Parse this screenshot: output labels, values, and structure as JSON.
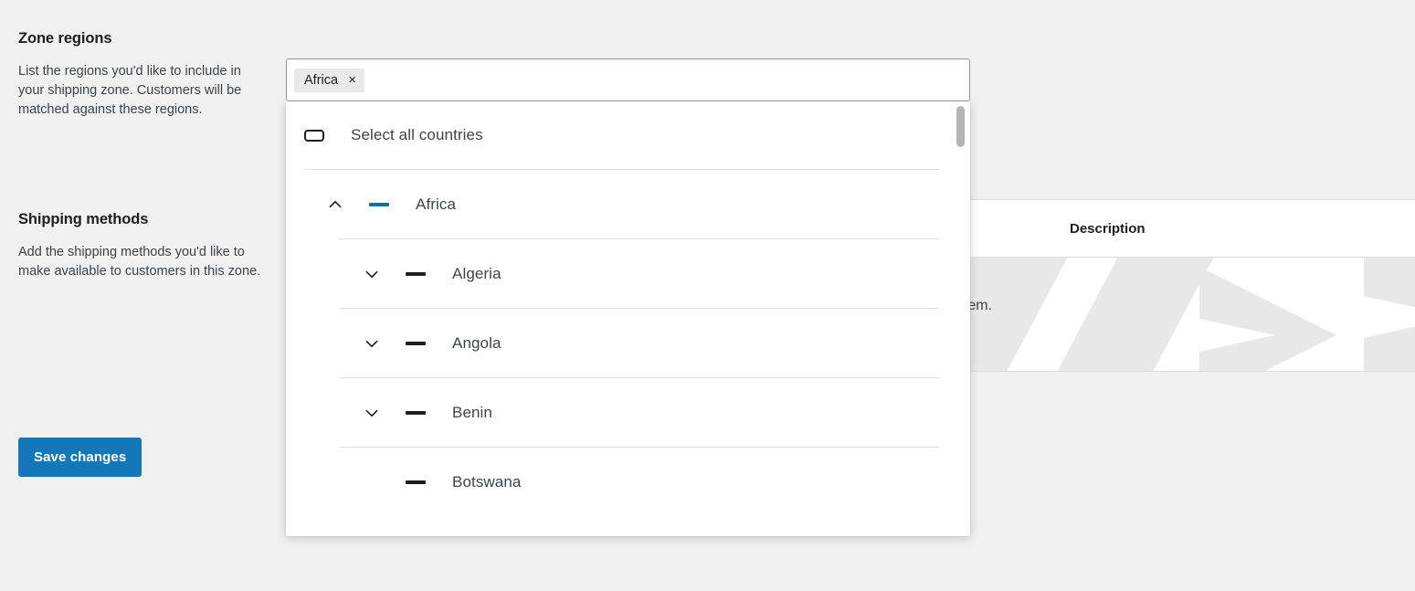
{
  "theme": {
    "accent_blue": "#1278ba",
    "indeterminate_blue": "#0e74a8",
    "indeterminate_dark": "#1e1e1e",
    "page_bg": "#f0f0f0",
    "panel_bg": "#ffffff"
  },
  "sidebar": {
    "zone_regions": {
      "title": "Zone regions",
      "description": "List the regions you'd like to include in your shipping zone. Customers will be matched against these regions."
    },
    "shipping_methods": {
      "title": "Shipping methods",
      "description": "Add the shipping methods you'd like to make available to customers in this zone."
    },
    "save_label": "Save changes"
  },
  "combobox": {
    "chips": [
      {
        "label": "Africa",
        "remove_glyph": "×"
      }
    ],
    "placeholder": ""
  },
  "background_table": {
    "columns": [
      {
        "label": "Description"
      }
    ],
    "empty_text": "thin the zone will see them."
  },
  "dropdown": {
    "scroll_position": "top",
    "rows": [
      {
        "label": "Select all countries",
        "level": "root",
        "checkbox": "unchecked",
        "has_chevron": false,
        "expanded": null
      },
      {
        "label": "Africa",
        "level": "group",
        "checkbox": "indeterminate-blue",
        "has_chevron": true,
        "expanded": true
      },
      {
        "label": "Algeria",
        "level": "country",
        "checkbox": "indeterminate-dark",
        "has_chevron": true,
        "expanded": false
      },
      {
        "label": "Angola",
        "level": "country",
        "checkbox": "indeterminate-dark",
        "has_chevron": true,
        "expanded": false
      },
      {
        "label": "Benin",
        "level": "country",
        "checkbox": "indeterminate-dark",
        "has_chevron": true,
        "expanded": false
      },
      {
        "label": "Botswana",
        "level": "country",
        "checkbox": "indeterminate-dark",
        "has_chevron": false,
        "expanded": null
      }
    ]
  }
}
